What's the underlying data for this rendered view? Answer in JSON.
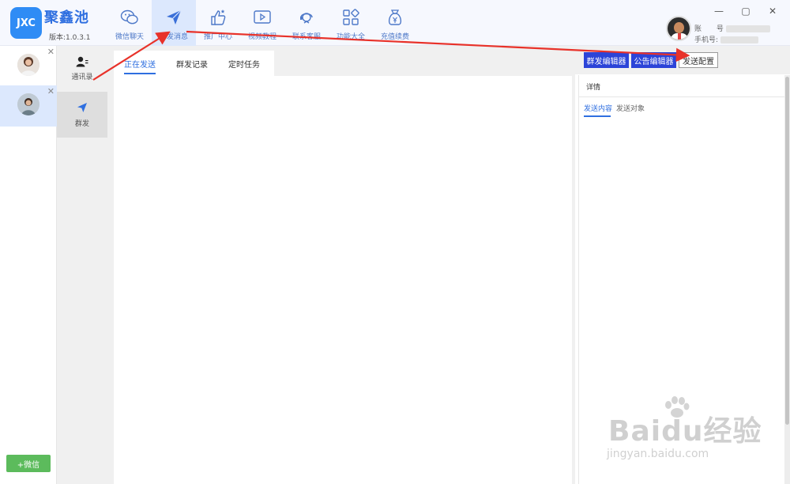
{
  "app": {
    "logo_text": "JXC",
    "name": "聚鑫池",
    "version": "版本:1.0.3.1"
  },
  "nav": {
    "items": [
      {
        "label": "微信聊天",
        "icon": "wechat-icon"
      },
      {
        "label": "群发消息",
        "icon": "send-icon"
      },
      {
        "label": "推广中心",
        "icon": "thumbs-up-icon"
      },
      {
        "label": "视频教程",
        "icon": "video-icon"
      },
      {
        "label": "联系客服",
        "icon": "support-icon"
      },
      {
        "label": "功能大全",
        "icon": "apps-grid-icon"
      },
      {
        "label": "充值续费",
        "icon": "money-bag-icon"
      }
    ],
    "active_index": 1
  },
  "account": {
    "account_label": "账",
    "account_partial": "号",
    "phone_label": "手机号:"
  },
  "window": {
    "minimize": "—",
    "maximize": "▢",
    "close": "✕"
  },
  "sidebar": {
    "close_glyph": "✕",
    "add_button": "+微信"
  },
  "functions": {
    "contacts": "通讯录",
    "mass_send": "群发"
  },
  "subtabs": [
    "正在发送",
    "群发记录",
    "定时任务"
  ],
  "right": {
    "btn_mass_editor": "群发编辑器",
    "btn_notice_editor": "公告编辑器",
    "btn_send_config": "发送配置",
    "detail_title": "详情",
    "tab_content": "发送内容",
    "tab_target": "发送对象"
  },
  "watermark": {
    "big": "Baidu经验",
    "small": "jingyan.baidu.com"
  },
  "colors": {
    "brand_blue": "#2f8cf5",
    "active_blue": "#2f6fe0",
    "button_blue": "#2c44d8",
    "add_green": "#5cbb5c",
    "arrow_red": "#e8322a"
  }
}
